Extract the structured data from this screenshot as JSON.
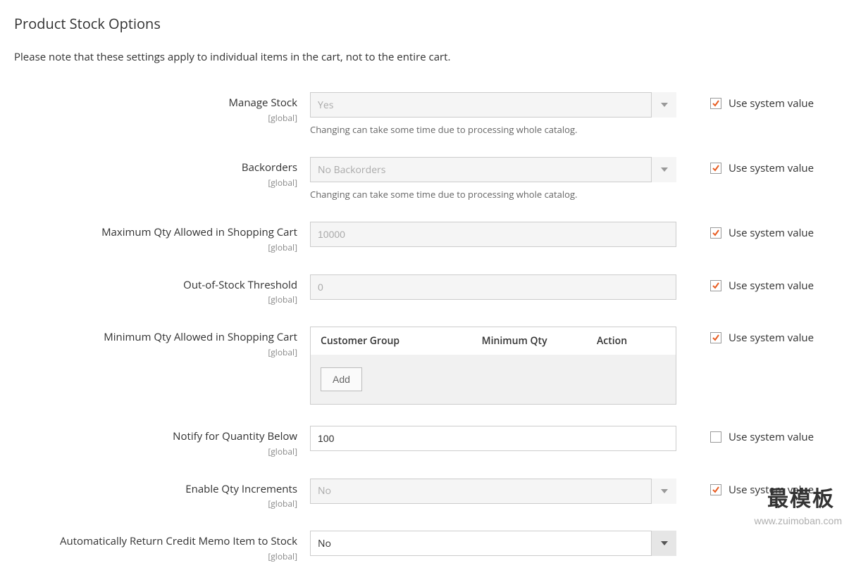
{
  "section": {
    "title": "Product Stock Options",
    "note": "Please note that these settings apply to individual items in the cart, not to the entire cart."
  },
  "scope_label": "[global]",
  "system_value_label": "Use system value",
  "fields": {
    "manage_stock": {
      "label": "Manage Stock",
      "value": "Yes",
      "helper": "Changing can take some time due to processing whole catalog.",
      "use_system": true
    },
    "backorders": {
      "label": "Backorders",
      "value": "No Backorders",
      "helper": "Changing can take some time due to processing whole catalog.",
      "use_system": true
    },
    "max_qty": {
      "label": "Maximum Qty Allowed in Shopping Cart",
      "value": "10000",
      "use_system": true
    },
    "threshold": {
      "label": "Out-of-Stock Threshold",
      "value": "0",
      "use_system": true
    },
    "min_qty": {
      "label": "Minimum Qty Allowed in Shopping Cart",
      "columns": {
        "c1": "Customer Group",
        "c2": "Minimum Qty",
        "c3": "Action"
      },
      "add_button": "Add",
      "use_system": true
    },
    "notify_below": {
      "label": "Notify for Quantity Below",
      "value": "100",
      "use_system": false
    },
    "qty_increments": {
      "label": "Enable Qty Increments",
      "value": "No",
      "use_system": true
    },
    "auto_return": {
      "label": "Automatically Return Credit Memo Item to Stock",
      "value": "No",
      "use_system": false
    }
  },
  "watermark": {
    "cn": "最模板",
    "en": "www.zuimoban.com"
  }
}
